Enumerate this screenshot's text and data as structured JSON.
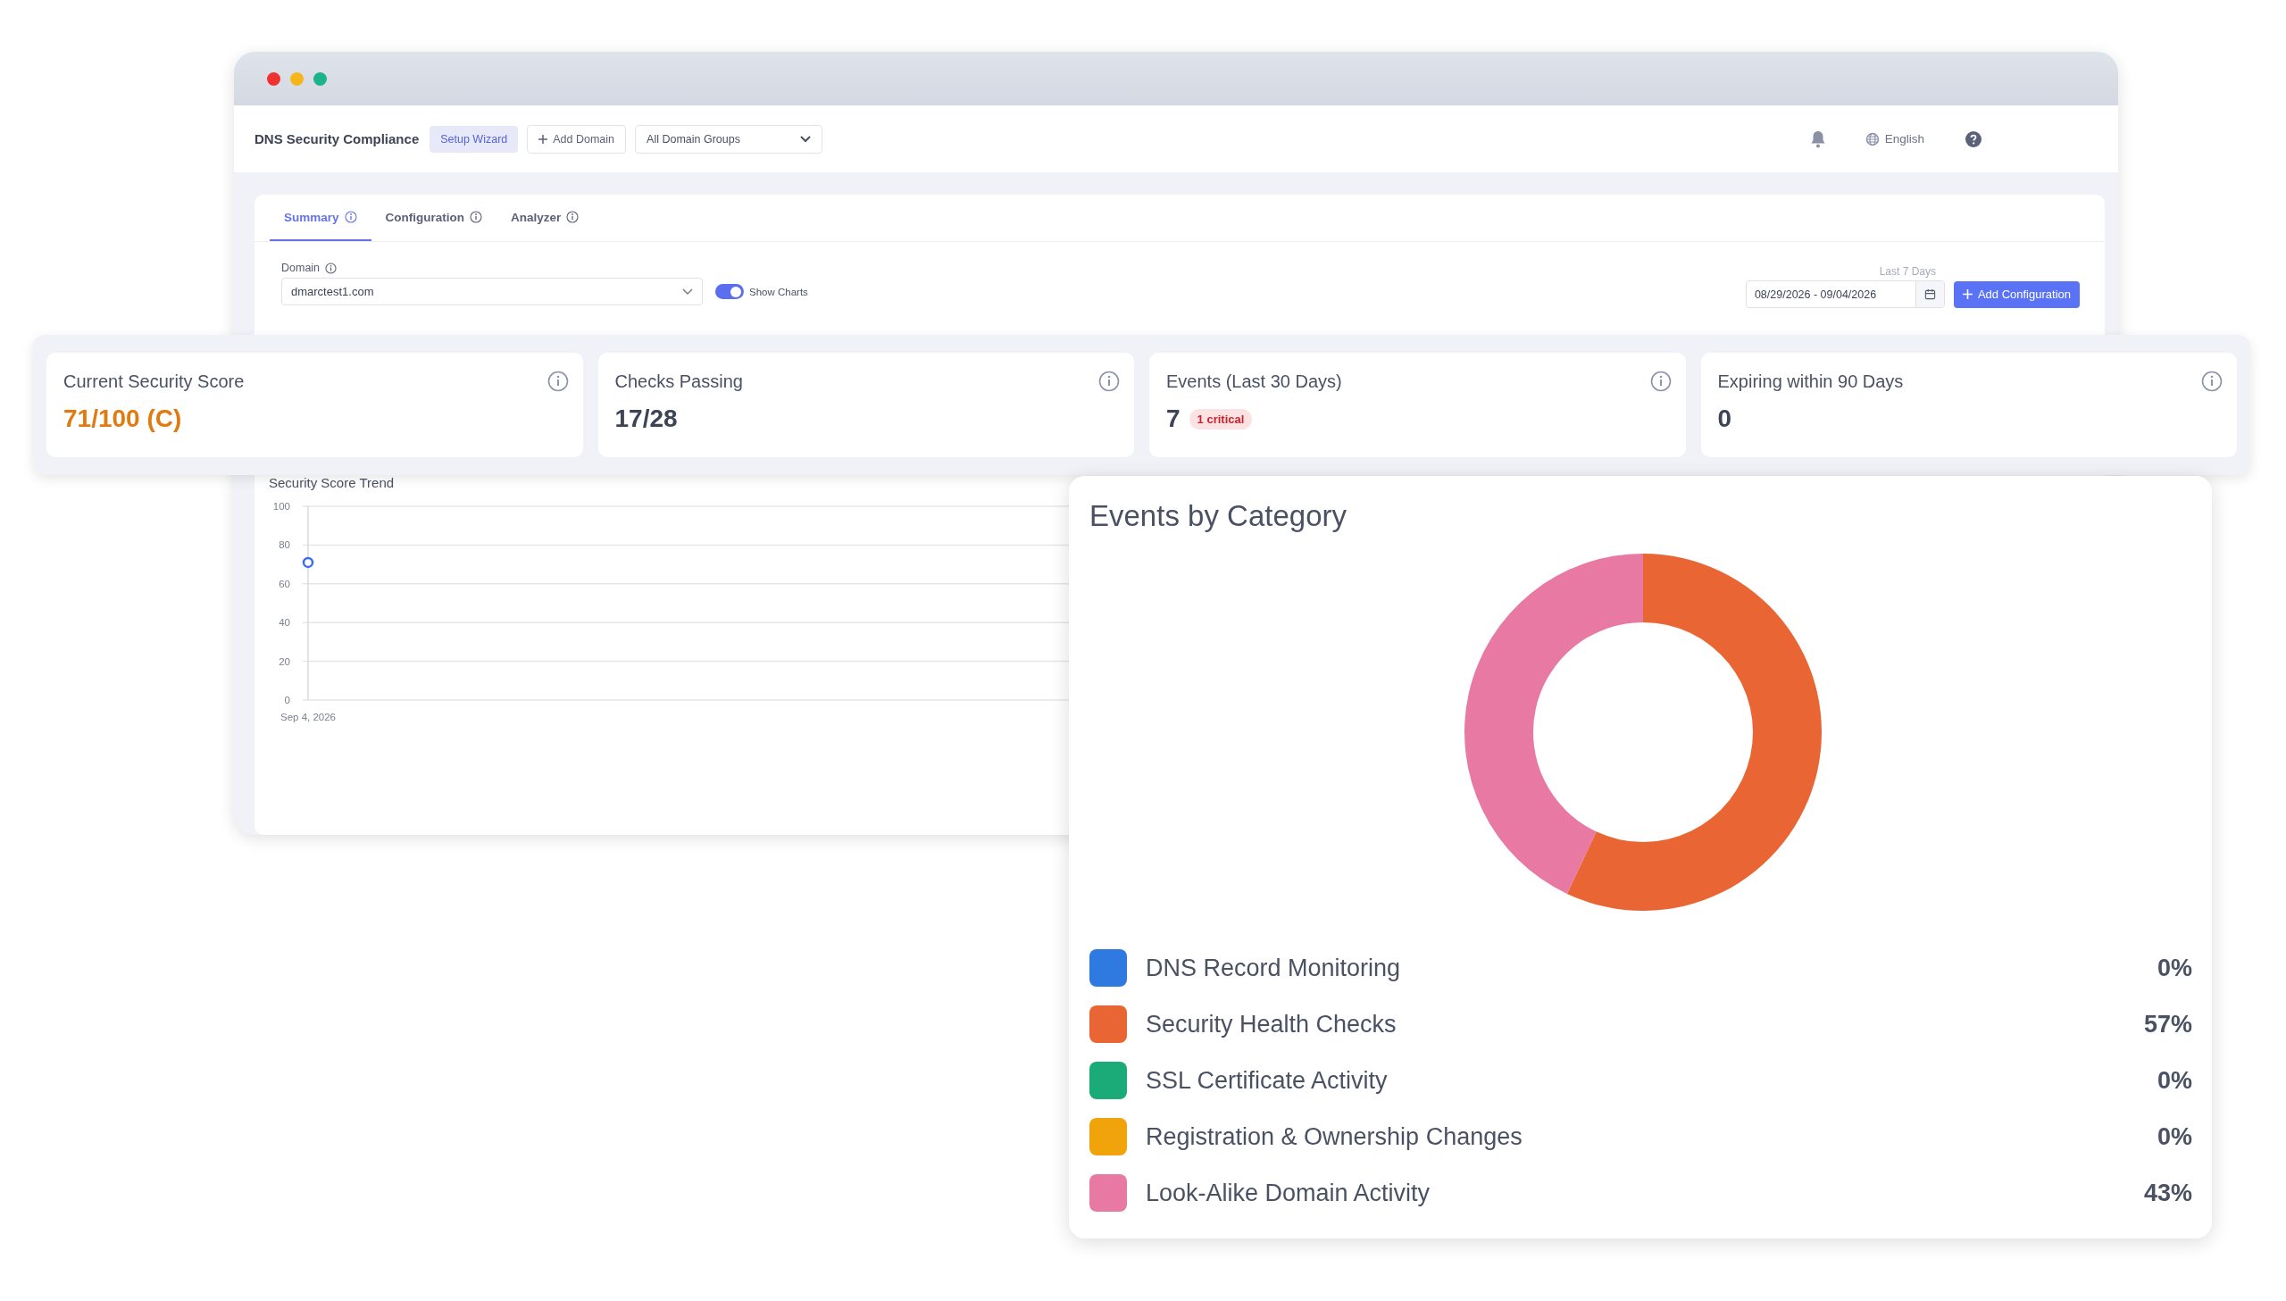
{
  "header": {
    "title": "DNS Security Compliance",
    "buttons": [
      {
        "label": "Setup Wizard",
        "kind": "soft"
      },
      {
        "label": "Add Domain",
        "kind": "add"
      }
    ],
    "group_select": "All Domain Groups",
    "language": "English"
  },
  "tabs": [
    {
      "label": "Summary",
      "selected": true
    },
    {
      "label": "Configuration",
      "selected": false
    },
    {
      "label": "Analyzer",
      "selected": false
    }
  ],
  "domain": {
    "label": "Domain",
    "value": "dmarctest1.com"
  },
  "show_charts": {
    "label": "Show Charts",
    "on": true
  },
  "date_range": {
    "caption": "Last 7 Days",
    "value": "08/29/2026 - 09/04/2026"
  },
  "add_button": "Add Configuration",
  "stats": [
    {
      "title": "Current Security Score",
      "value": "71/100 (C)",
      "highlight": true
    },
    {
      "title": "Checks Passing",
      "value": "17/28",
      "highlight": false
    },
    {
      "title": "Events (Last 30 Days)",
      "value": "7",
      "highlight": false,
      "badge": "1 critical"
    },
    {
      "title": "Expiring within 90 Days",
      "value": "0",
      "highlight": false
    }
  ],
  "trend": {
    "title": "Security Score Trend",
    "chart_data": {
      "type": "line",
      "grid": true,
      "x": [
        "Sep 4, 2026"
      ],
      "ylim": [
        0,
        100
      ],
      "yticks": [
        0,
        20,
        40,
        60,
        80,
        100
      ],
      "series": [
        {
          "color": "#3b6cf6",
          "marker": true,
          "values": [
            71
          ]
        }
      ]
    }
  },
  "events": {
    "title": "Events by Category",
    "chart_data": {
      "type": "donut",
      "categories": [
        "DNS Record Monitoring",
        "Security Health Checks",
        "SSL Certificate Activity",
        "Registration & Ownership Changes",
        "Look-Alike Domain Activity"
      ],
      "values": [
        0,
        57,
        0,
        0,
        43
      ]
    },
    "legend": [
      {
        "color": "#2f7ae0",
        "percent": "0%"
      },
      {
        "color": "#ea6534",
        "percent": "57%"
      },
      {
        "color": "#1aab78",
        "percent": "0%"
      },
      {
        "color": "#f0a30a",
        "percent": "0%"
      },
      {
        "color": "#e879a3",
        "percent": "43%"
      }
    ]
  }
}
